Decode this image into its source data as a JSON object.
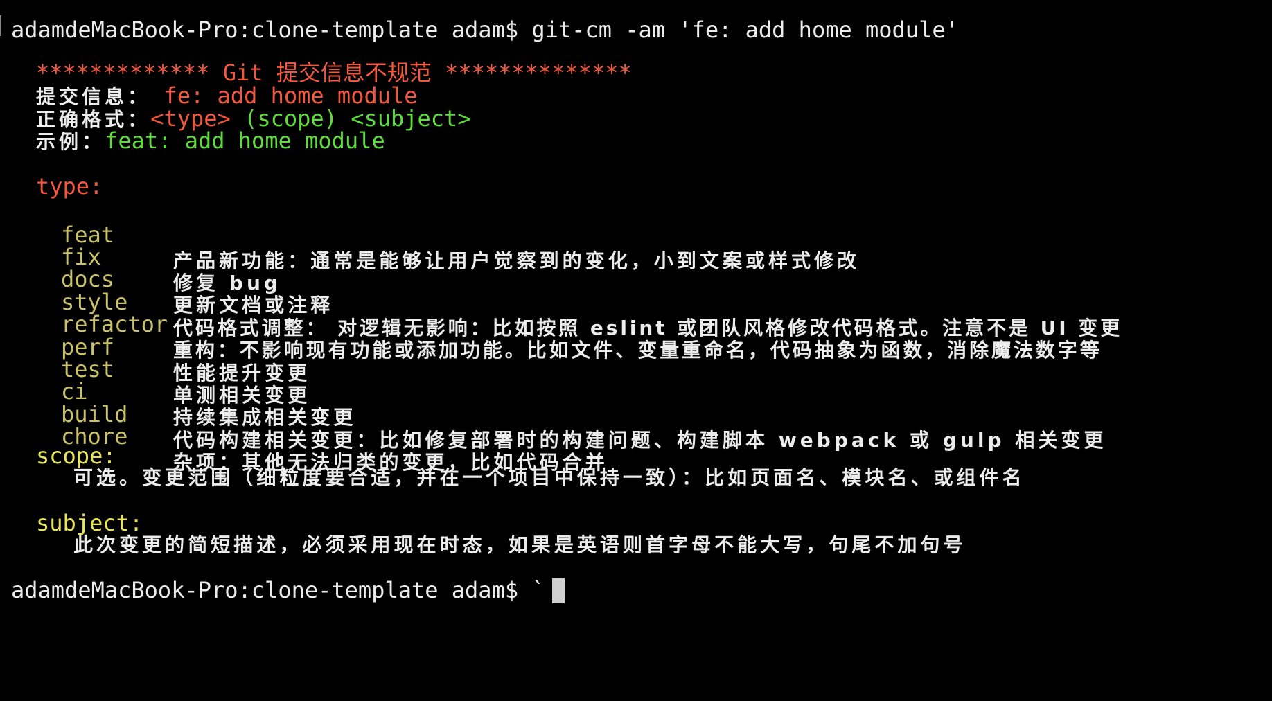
{
  "terminal": {
    "command_line": {
      "prompt": "adamdeMacBook-Pro:clone-template adam$",
      "command": "git-cm -am 'fe: add home module'"
    },
    "banner": "************* Git 提交信息不规范 **************",
    "commit_message": {
      "label": "提交信息：",
      "value": "fe: add home module"
    },
    "correct_format": {
      "label": "正确格式：",
      "type": "<type>",
      "scope": "(scope)",
      "subject": "<subject>"
    },
    "example": {
      "label": "示例：",
      "value": "feat: add home module"
    },
    "type_section": {
      "heading": "type:",
      "items": [
        {
          "key": "feat",
          "desc": "产品新功能：通常是能够让用户觉察到的变化，小到文案或样式修改"
        },
        {
          "key": "fix",
          "desc": "修复 bug"
        },
        {
          "key": "docs",
          "desc": "更新文档或注释"
        },
        {
          "key": "style",
          "desc": "代码格式调整： 对逻辑无影响：比如按照 eslint 或团队风格修改代码格式。注意不是 UI 变更"
        },
        {
          "key": "refactor",
          "desc": "重构：不影响现有功能或添加功能。比如文件、变量重命名，代码抽象为函数，消除魔法数字等"
        },
        {
          "key": "perf",
          "desc": "性能提升变更"
        },
        {
          "key": "test",
          "desc": "单测相关变更"
        },
        {
          "key": "ci",
          "desc": "持续集成相关变更"
        },
        {
          "key": "build",
          "desc": "代码构建相关变更：比如修复部署时的构建问题、构建脚本 webpack 或 gulp 相关变更"
        },
        {
          "key": "chore",
          "desc": "杂项：其他无法归类的变更，比如代码合并"
        }
      ]
    },
    "scope_section": {
      "heading": "scope:",
      "desc": "可选。变更范围（细粒度要合适，并在一个项目中保持一致）：比如页面名、模块名、或组件名"
    },
    "subject_section": {
      "heading": "subject:",
      "desc": "此次变更的简短描述，必须采用现在时态，如果是英语则首字母不能大写，句尾不加句号"
    },
    "final_prompt": {
      "prompt": "adamdeMacBook-Pro:clone-template adam$",
      "input": "`"
    },
    "colors": {
      "background": "#000000",
      "text": "#ececec",
      "error_red": "#f2583e",
      "ok_green": "#5fdb3f",
      "heading_yellow": "#e7e45c",
      "type_key_olive": "#c9c26a"
    }
  }
}
